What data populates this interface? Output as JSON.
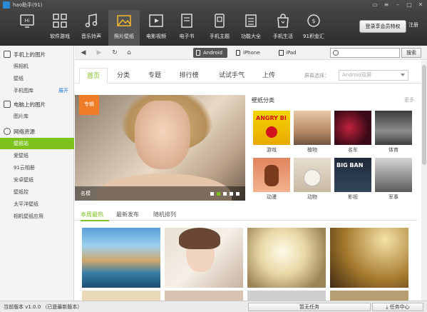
{
  "window": {
    "title": "hao助手(91)"
  },
  "toolbar": {
    "items": [
      {
        "label": "",
        "icon": "hi-phone-icon"
      },
      {
        "label": "软件游戏",
        "icon": "apps-grid-icon"
      },
      {
        "label": "音乐铃声",
        "icon": "music-note-icon"
      },
      {
        "label": "照片壁纸",
        "icon": "photo-icon"
      },
      {
        "label": "电影视频",
        "icon": "video-icon"
      },
      {
        "label": "电子书",
        "icon": "book-icon"
      },
      {
        "label": "手机主题",
        "icon": "theme-icon"
      },
      {
        "label": "功能大全",
        "icon": "tools-icon"
      },
      {
        "label": "手机生活",
        "icon": "shopping-bag-icon"
      },
      {
        "label": "91积金汇",
        "icon": "coin-icon"
      }
    ],
    "active_index": 3,
    "vip_label": "登录享会员特权",
    "register_label": "注册"
  },
  "sidebar": {
    "sections": [
      {
        "title": "手机上的图片",
        "items": [
          "照相机",
          "壁纸",
          "手机图库"
        ],
        "expand_label": "展开"
      },
      {
        "title": "电脑上的图片",
        "items": [
          "图片库"
        ]
      },
      {
        "title": "网络资源",
        "items": [
          "壁纸站",
          "爱壁纸",
          "91云相册",
          "安卓壁纸",
          "壁纸控",
          "太平洋壁纸",
          "相机壁纸应用"
        ]
      }
    ],
    "active_item": "壁纸站"
  },
  "addressbar": {
    "device_tabs": [
      "Android",
      "iPhone",
      "iPad"
    ],
    "active_device": "Android",
    "search_placeholder": "",
    "search_button": "搜索"
  },
  "content": {
    "tabs": [
      "首页",
      "分类",
      "专题",
      "排行榜",
      "试试手气",
      "上传"
    ],
    "active_tab": "首页",
    "screen_label": "屏幕选择：",
    "screen_value": "Android双屏",
    "banner": {
      "tag": "专辑",
      "caption": "名模",
      "dots": 5,
      "active_dot": 1
    },
    "categories": {
      "title": "壁纸分类",
      "more": "更多",
      "items": [
        {
          "label": "游戏",
          "thumb_text": "ANGRY BI"
        },
        {
          "label": "植物",
          "thumb_text": ""
        },
        {
          "label": "名车",
          "thumb_text": ""
        },
        {
          "label": "体育",
          "thumb_text": ""
        },
        {
          "label": "动漫",
          "thumb_text": ""
        },
        {
          "label": "动物",
          "thumb_text": ""
        },
        {
          "label": "影视",
          "thumb_text": "BIG BAN"
        },
        {
          "label": "军事",
          "thumb_text": ""
        }
      ]
    },
    "subtabs": [
      "本周最热",
      "最新发布",
      "随机排列"
    ],
    "active_subtab": "本周最热"
  },
  "statusbar": {
    "version": "当前版本 v1.0.0 （已是最新版本）",
    "pause_button": "暂无任务",
    "task_button": "任务中心"
  },
  "colors": {
    "accent": "#7dc21e",
    "toolbar_bg": "#3a3a3a",
    "banner_tag": "#f07c28"
  }
}
